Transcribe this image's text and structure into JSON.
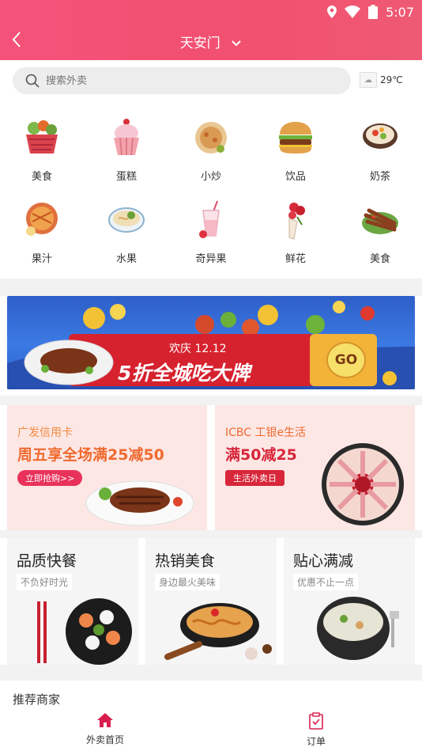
{
  "status_bar": {
    "time": "5:07"
  },
  "header": {
    "city": "天安门"
  },
  "search": {
    "placeholder": "搜索外卖"
  },
  "weather": {
    "temp": "29℃"
  },
  "categories": [
    {
      "label": "美食",
      "icon": "food-basket-icon"
    },
    {
      "label": "蛋糕",
      "icon": "cupcake-icon"
    },
    {
      "label": "小炒",
      "icon": "stir-fry-icon"
    },
    {
      "label": "饮品",
      "icon": "burger-icon"
    },
    {
      "label": "奶茶",
      "icon": "bowl-dish-icon"
    },
    {
      "label": "果汁",
      "icon": "pie-icon"
    },
    {
      "label": "水果",
      "icon": "noodle-bowl-icon"
    },
    {
      "label": "奇异果",
      "icon": "milkshake-icon"
    },
    {
      "label": "鲜花",
      "icon": "flower-bouquet-icon"
    },
    {
      "label": "美食",
      "icon": "skewer-plate-icon"
    }
  ],
  "banner": {
    "line1": "欢庆 12.12",
    "line2": "5折全城吃大牌",
    "go": "GO"
  },
  "promos": [
    {
      "title": "广发信用卡",
      "headline_a": "周五享全场满",
      "headline_b": "25减50",
      "badge": "立即抢购>>"
    },
    {
      "title": "ICBC 工银e生活",
      "headline_a": "满",
      "headline_b": "50减25",
      "badge": "生活外卖日"
    }
  ],
  "features": [
    {
      "title": "品质快餐",
      "subtitle": "不负好时光"
    },
    {
      "title": "热销美食",
      "subtitle": "身边最火美味"
    },
    {
      "title": "贴心满减",
      "subtitle": "优惠不止一点"
    }
  ],
  "recommend": {
    "title": "推荐商家"
  },
  "tabs": [
    {
      "label": "外卖首页",
      "color": "#d81e4e"
    },
    {
      "label": "订单",
      "color": "#333333"
    }
  ],
  "colors": {
    "accent": "#f2506f",
    "tab_active": "#d81e4e"
  }
}
